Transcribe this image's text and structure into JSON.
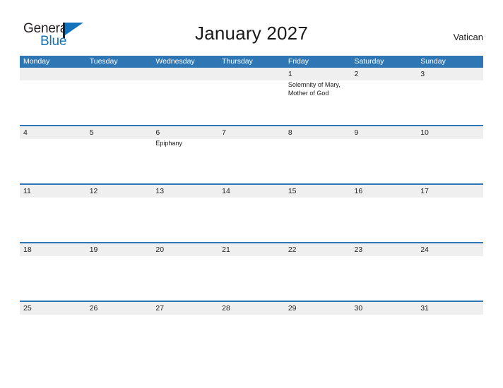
{
  "brand": {
    "name_top": "General",
    "name_bottom": "Blue",
    "accent_color": "#1272bb",
    "text_color": "#231f20"
  },
  "header": {
    "title": "January 2027",
    "country": "Vatican"
  },
  "theme": {
    "header_blue": "#2f76b5",
    "band_gray": "#efefef",
    "row_border": "#2f76b5",
    "page_background": "#ffffff"
  },
  "weekdays": [
    {
      "label": "Monday"
    },
    {
      "label": "Tuesday"
    },
    {
      "label": "Wednesday"
    },
    {
      "label": "Thursday"
    },
    {
      "label": "Friday"
    },
    {
      "label": "Saturday"
    },
    {
      "label": "Sunday"
    }
  ],
  "weeks": [
    {
      "bordered": false,
      "days": [
        {
          "num": "",
          "events": []
        },
        {
          "num": "",
          "events": []
        },
        {
          "num": "",
          "events": []
        },
        {
          "num": "",
          "events": []
        },
        {
          "num": "1",
          "events": [
            {
              "title": "Solemnity of Mary, Mother of God"
            }
          ]
        },
        {
          "num": "2",
          "events": []
        },
        {
          "num": "3",
          "events": []
        }
      ]
    },
    {
      "bordered": true,
      "days": [
        {
          "num": "4",
          "events": []
        },
        {
          "num": "5",
          "events": []
        },
        {
          "num": "6",
          "events": [
            {
              "title": "Epiphany"
            }
          ]
        },
        {
          "num": "7",
          "events": []
        },
        {
          "num": "8",
          "events": []
        },
        {
          "num": "9",
          "events": []
        },
        {
          "num": "10",
          "events": []
        }
      ]
    },
    {
      "bordered": true,
      "days": [
        {
          "num": "11",
          "events": []
        },
        {
          "num": "12",
          "events": []
        },
        {
          "num": "13",
          "events": []
        },
        {
          "num": "14",
          "events": []
        },
        {
          "num": "15",
          "events": []
        },
        {
          "num": "16",
          "events": []
        },
        {
          "num": "17",
          "events": []
        }
      ]
    },
    {
      "bordered": true,
      "days": [
        {
          "num": "18",
          "events": []
        },
        {
          "num": "19",
          "events": []
        },
        {
          "num": "20",
          "events": []
        },
        {
          "num": "21",
          "events": []
        },
        {
          "num": "22",
          "events": []
        },
        {
          "num": "23",
          "events": []
        },
        {
          "num": "24",
          "events": []
        }
      ]
    },
    {
      "bordered": true,
      "days": [
        {
          "num": "25",
          "events": []
        },
        {
          "num": "26",
          "events": []
        },
        {
          "num": "27",
          "events": []
        },
        {
          "num": "28",
          "events": []
        },
        {
          "num": "29",
          "events": []
        },
        {
          "num": "30",
          "events": []
        },
        {
          "num": "31",
          "events": []
        }
      ]
    }
  ]
}
